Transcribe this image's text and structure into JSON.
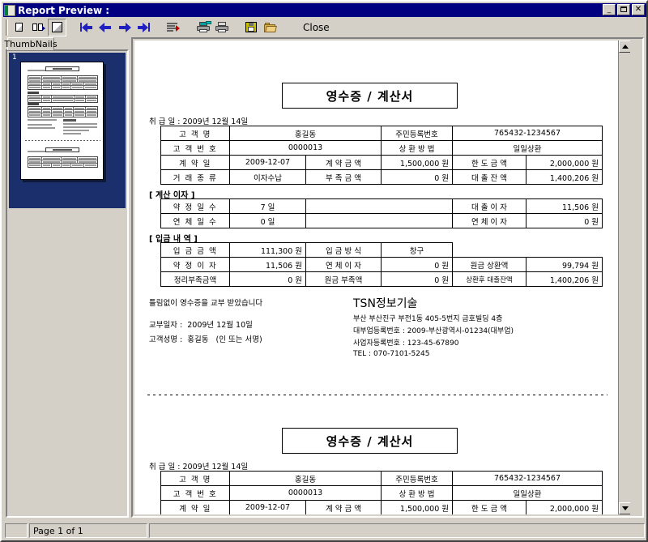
{
  "window": {
    "title": "Report Preview :",
    "icon": "report-icon",
    "buttons": {
      "minimize": "_",
      "maximize": "□",
      "close": "✕"
    }
  },
  "toolbar": {
    "items": [
      {
        "name": "single-page-view",
        "icon": "single-page-icon",
        "tooltip": "Single Page"
      },
      {
        "name": "facing-pages-view",
        "icon": "two-page-icon",
        "tooltip": "Two Pages"
      },
      {
        "name": "whole-page-view",
        "icon": "whole-page-icon",
        "tooltip": "Whole Page",
        "pressed": true
      },
      {
        "name": "first-page",
        "icon": "first-page-arrow-icon",
        "tooltip": "First Page"
      },
      {
        "name": "previous-page",
        "icon": "previous-page-arrow-icon",
        "tooltip": "Previous Page"
      },
      {
        "name": "next-page",
        "icon": "next-page-arrow-icon",
        "tooltip": "Next Page"
      },
      {
        "name": "last-page",
        "icon": "last-page-arrow-icon",
        "tooltip": "Last Page"
      },
      {
        "name": "goto-page",
        "icon": "goto-page-icon",
        "tooltip": "Go To Page"
      },
      {
        "name": "printer-setup",
        "icon": "printer-setup-icon",
        "tooltip": "Printer Setup"
      },
      {
        "name": "print",
        "icon": "printer-icon",
        "tooltip": "Print"
      },
      {
        "name": "save-report",
        "icon": "floppy-disk-icon",
        "tooltip": "Save"
      },
      {
        "name": "open-report",
        "icon": "open-folder-icon",
        "tooltip": "Open"
      }
    ],
    "close_label": "Close",
    "close_accel": "C"
  },
  "thumbnails": {
    "tab_label": "ThumbNails",
    "pages": [
      {
        "number": "1",
        "selected": true
      }
    ],
    "selection_color": "#1a2f6b"
  },
  "status_bar": {
    "page_indicator": "Page 1 of 1"
  },
  "document": {
    "receipts": [
      {
        "title": "영수증 / 계산서",
        "handling_date_label": "취 급 일 :",
        "handling_date": "2009년 12월 14일",
        "customer_table": {
          "rows": [
            [
              {
                "t": "고 객 명",
                "k": "lbl"
              },
              {
                "t": "홍길동",
                "k": "ctr",
                "span": 2
              },
              {
                "t": "주민등록번호",
                "k": "ctr"
              },
              {
                "t": "765432-1234567",
                "k": "ctr",
                "span": 2
              }
            ],
            [
              {
                "t": "고 객 번 호",
                "k": "lbl"
              },
              {
                "t": "0000013",
                "k": "ctr",
                "span": 2
              },
              {
                "t": "상 환 방 법",
                "k": "ctr"
              },
              {
                "t": "일일상환",
                "k": "ctr",
                "span": 2
              }
            ],
            [
              {
                "t": "계 약 일",
                "k": "lbl"
              },
              {
                "t": "2009-12-07",
                "k": "ctr"
              },
              {
                "t": "계 약 금 액",
                "k": "ctr"
              },
              {
                "t": "1,500,000 원",
                "k": "num"
              },
              {
                "t": "한 도 금 액",
                "k": "ctr"
              },
              {
                "t": "2,000,000 원",
                "k": "num"
              }
            ],
            [
              {
                "t": "거 래 종 류",
                "k": "lbl"
              },
              {
                "t": "이자수납",
                "k": "ctr"
              },
              {
                "t": "부 족 금 액",
                "k": "ctr"
              },
              {
                "t": "0 원",
                "k": "num"
              },
              {
                "t": "대 출 잔 액",
                "k": "ctr"
              },
              {
                "t": "1,400,206 원",
                "k": "num"
              }
            ]
          ]
        },
        "interest_section_label": "[ 계산 이자 ]",
        "interest_table": {
          "rows": [
            [
              {
                "t": "약 정 일 수",
                "k": "lbl"
              },
              {
                "t": "7 일",
                "k": "ctr"
              },
              {
                "t": "",
                "k": "blank"
              },
              {
                "t": "대 출 이 자",
                "k": "ctr"
              },
              {
                "t": "11,506 원",
                "k": "num"
              }
            ],
            [
              {
                "t": "연 체 일 수",
                "k": "lbl"
              },
              {
                "t": "0 일",
                "k": "ctr"
              },
              {
                "t": "",
                "k": "blank"
              },
              {
                "t": "연 체 이 자",
                "k": "ctr"
              },
              {
                "t": "0 원",
                "k": "num"
              }
            ]
          ]
        },
        "deposit_section_label": "[ 입금 내 역 ]",
        "deposit_table": {
          "rows": [
            [
              {
                "t": "입 금 금 액",
                "k": "lbl"
              },
              {
                "t": "111,300 원",
                "k": "num"
              },
              {
                "t": "입 금 방 식",
                "k": "ctr"
              },
              {
                "t": "창구",
                "k": "ctr"
              },
              {
                "t": "",
                "k": "nob"
              },
              {
                "t": "",
                "k": "nob"
              }
            ],
            [
              {
                "t": "약 정 이 자",
                "k": "lbl"
              },
              {
                "t": "11,506 원",
                "k": "num"
              },
              {
                "t": "연 체 이 자",
                "k": "ctr"
              },
              {
                "t": "0 원",
                "k": "num"
              },
              {
                "t": "원금 상환액",
                "k": "ctr"
              },
              {
                "t": "99,794 원",
                "k": "num"
              }
            ],
            [
              {
                "t": "정리부족금액",
                "k": "ctr"
              },
              {
                "t": "0 원",
                "k": "num"
              },
              {
                "t": "원금 부족액",
                "k": "ctr"
              },
              {
                "t": "0 원",
                "k": "num"
              },
              {
                "t": "상환후 대출잔액",
                "k": "ctr"
              },
              {
                "t": "1,400,206 원",
                "k": "num"
              }
            ]
          ]
        },
        "confirm_text": "틀림없이 영수증을 교부 받았습니다",
        "issue_date_label": "교부일자 :",
        "issue_date": "2009년 12월 10일",
        "customer_name_label": "고객성명 :",
        "customer_name": "홍길동",
        "signature_note": "(인 또는 서명)",
        "company": {
          "name": "TSN정보기술",
          "address": "부산 부산진구 부전1동 405-5번지 금호빌딩 4층",
          "lender_reg": "대부업등록번호 : 2009-부산광역시-01234(대부업)",
          "business_reg": "사업자등록번호 : 123-45-67890",
          "tel": "TEL : 070-7101-5245"
        }
      },
      {
        "title": "영수증 / 계산서",
        "handling_date_label": "취 급 일 :",
        "handling_date": "2009년 12월 14일",
        "customer_table": {
          "rows": [
            [
              {
                "t": "고 객 명",
                "k": "lbl"
              },
              {
                "t": "홍길동",
                "k": "ctr",
                "span": 2
              },
              {
                "t": "주민등록번호",
                "k": "ctr"
              },
              {
                "t": "765432-1234567",
                "k": "ctr",
                "span": 2
              }
            ],
            [
              {
                "t": "고 객 번 호",
                "k": "lbl"
              },
              {
                "t": "0000013",
                "k": "ctr",
                "span": 2
              },
              {
                "t": "상 환 방 법",
                "k": "ctr"
              },
              {
                "t": "일일상환",
                "k": "ctr",
                "span": 2
              }
            ],
            [
              {
                "t": "계 약 일",
                "k": "lbl"
              },
              {
                "t": "2009-12-07",
                "k": "ctr"
              },
              {
                "t": "계 약 금 액",
                "k": "ctr"
              },
              {
                "t": "1,500,000 원",
                "k": "num"
              },
              {
                "t": "한 도 금 액",
                "k": "ctr"
              },
              {
                "t": "2,000,000 원",
                "k": "num"
              }
            ]
          ]
        }
      }
    ]
  }
}
